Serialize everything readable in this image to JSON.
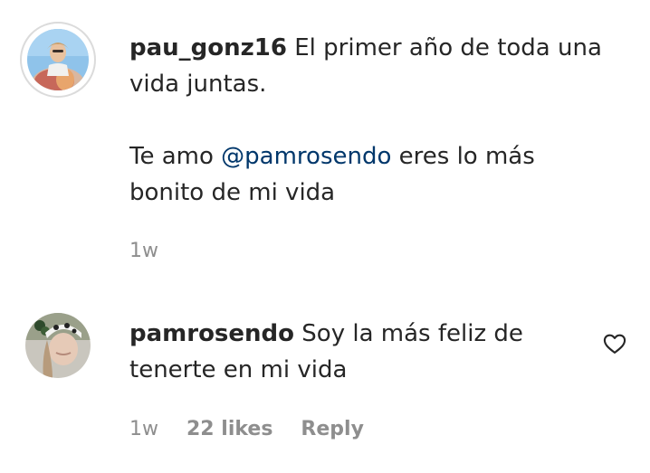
{
  "comments": [
    {
      "username": "pau_gonz16",
      "text_line1": "El primer año de toda una",
      "text_line2": "vida juntas.",
      "text_pre_mention": "Te amo ",
      "mention": "@pamrosendo",
      "text_post_mention": " eres lo más",
      "text_line4": "bonito de mi vida",
      "time": "1w"
    },
    {
      "username": "pamrosendo",
      "text_line1": "Soy la más feliz de",
      "text_line2": "tenerte en mi vida",
      "time": "1w",
      "likes": "22 likes",
      "reply_label": "Reply"
    }
  ],
  "icons": {
    "like": "heart-outline-icon"
  },
  "colors": {
    "text": "#262626",
    "secondary": "#8e8e8e",
    "mention": "#00376b"
  }
}
